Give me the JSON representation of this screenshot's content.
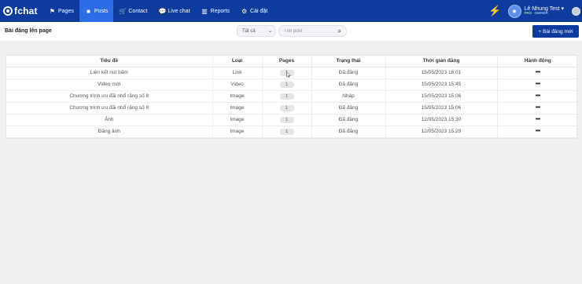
{
  "brand": {
    "name": "fchat"
  },
  "nav": [
    {
      "label": "Pages",
      "icon": "flag-icon",
      "glyph": "⚑",
      "active": false
    },
    {
      "label": "Posts",
      "icon": "posts-icon",
      "glyph": "■",
      "active": true
    },
    {
      "label": "Contact",
      "icon": "cart-icon",
      "glyph": "🛒",
      "active": false
    },
    {
      "label": "Live chat",
      "icon": "chat-icon",
      "glyph": "💬",
      "active": false
    },
    {
      "label": "Reports",
      "icon": "bar-chart-icon",
      "glyph": "▥",
      "active": false
    },
    {
      "label": "Cài đặt",
      "icon": "gear-icon",
      "glyph": "⚙",
      "active": false
    }
  ],
  "user": {
    "name": "Lê Nhung Test",
    "badge": "PRO",
    "role": "OWNER"
  },
  "subbar": {
    "title": "Bài đăng lên page",
    "filter_value": "Tất cả",
    "search_placeholder": "Tìm post",
    "new_post_label": "+ Bài đăng mới"
  },
  "table": {
    "headers": [
      "Tiêu đề",
      "Loại",
      "Pages",
      "Trạng thái",
      "Thời gian đăng",
      "Hành động"
    ],
    "rows": [
      {
        "title": "Liên kết nút bấm",
        "type": "Link",
        "pages": "1",
        "status": "Đã đăng",
        "time": "15/05/2023 16:01",
        "action": "•••"
      },
      {
        "title": "Video mới",
        "type": "Video",
        "pages": "1",
        "status": "Đã đăng",
        "time": "15/05/2023 15:45",
        "action": "•••"
      },
      {
        "title": "Chương trình ưu đãi nhổ răng số 8",
        "type": "Image",
        "pages": "1",
        "status": "Nháp",
        "time": "15/05/2023 15:06",
        "action": "•••"
      },
      {
        "title": "Chương trình ưu đãi nhổ răng số 8",
        "type": "Image",
        "pages": "1",
        "status": "Đã đăng",
        "time": "15/05/2023 15:06",
        "action": "•••"
      },
      {
        "title": "Ảnh",
        "type": "Image",
        "pages": "1",
        "status": "Đã đăng",
        "time": "12/05/2023 15:30",
        "action": "•••"
      },
      {
        "title": "Đăng ảnh",
        "type": "Image",
        "pages": "1",
        "status": "Đã đăng",
        "time": "12/05/2023 15:29",
        "action": "•••"
      }
    ]
  },
  "colors": {
    "header_bg": "#0d3b9e",
    "active_tab": "#2c6ce6",
    "flash": "#f2c21a"
  }
}
